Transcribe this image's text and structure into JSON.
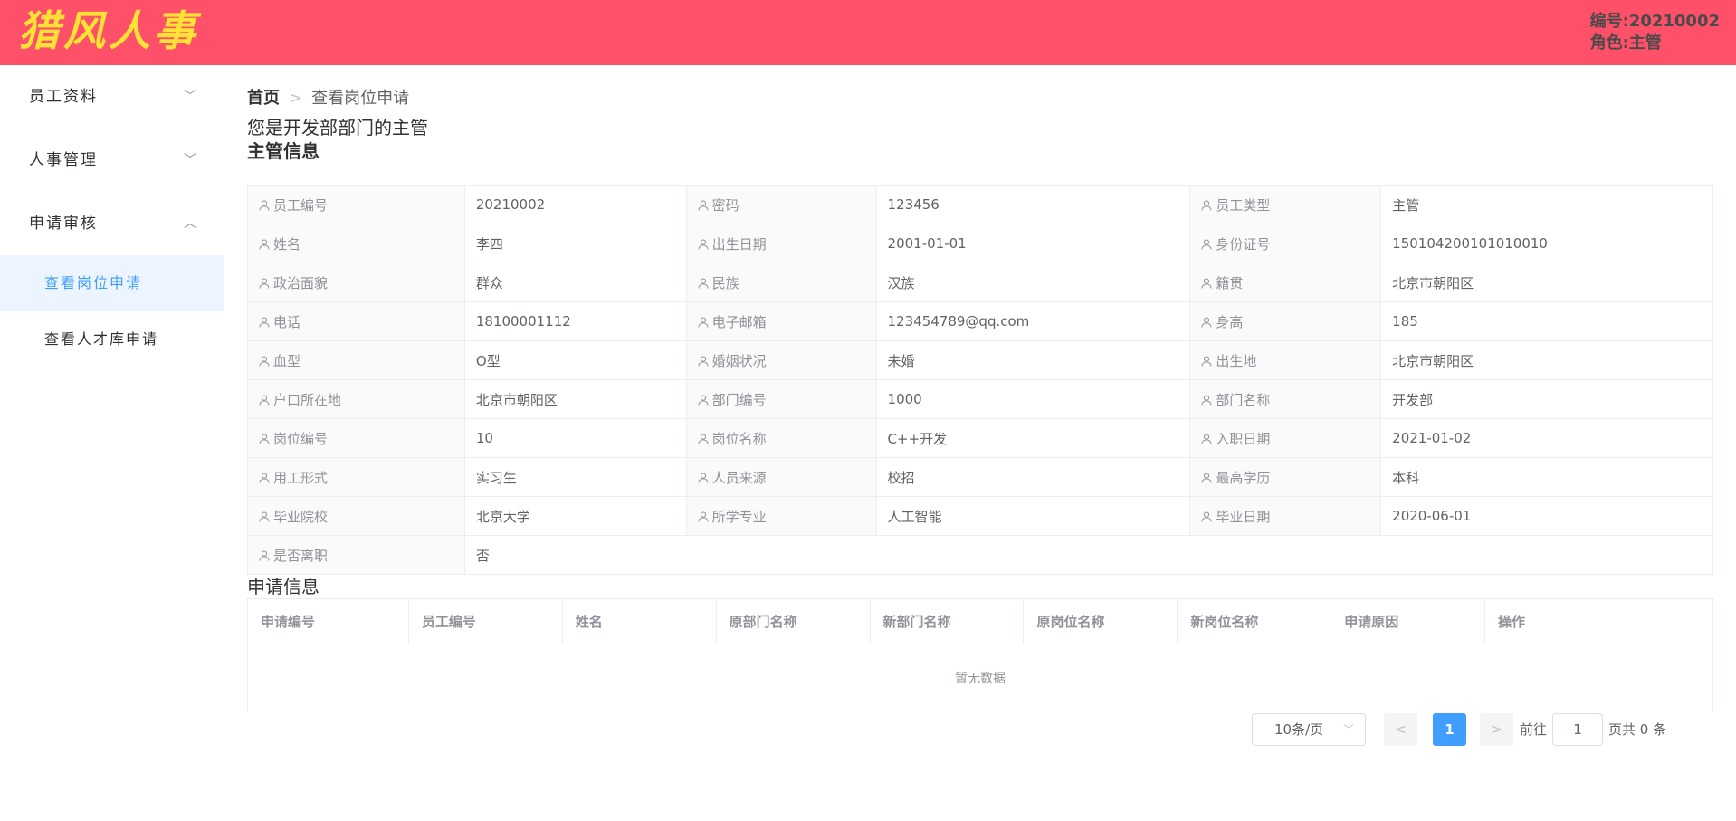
{
  "header": {
    "logo": "猎风人事",
    "user_no": "编号:20210002",
    "role": "角色:主管"
  },
  "sidebar": {
    "menus": [
      {
        "label": "员工资料",
        "chevron": "﹀"
      },
      {
        "label": "人事管理",
        "chevron": "﹀"
      },
      {
        "label": "申请审核",
        "chevron": "︿"
      }
    ],
    "sub_items": [
      {
        "label": "查看岗位申请",
        "active": true
      },
      {
        "label": "查看人才库申请",
        "active": false
      }
    ]
  },
  "breadcrumb": {
    "home": "首页",
    "separator": ">",
    "current": "查看岗位申请"
  },
  "intro": "您是开发部部门的主管",
  "manager_title": "主管信息",
  "details": [
    [
      {
        "label": "员工编号",
        "value": "20210002"
      },
      {
        "label": "密码",
        "value": "123456"
      },
      {
        "label": "员工类型",
        "value": "主管"
      }
    ],
    [
      {
        "label": "姓名",
        "value": "李四"
      },
      {
        "label": "出生日期",
        "value": "2001-01-01"
      },
      {
        "label": "身份证号",
        "value": "150104200101010010"
      }
    ],
    [
      {
        "label": "政治面貌",
        "value": "群众"
      },
      {
        "label": "民族",
        "value": "汉族"
      },
      {
        "label": "籍贯",
        "value": "北京市朝阳区"
      }
    ],
    [
      {
        "label": "电话",
        "value": "18100001112"
      },
      {
        "label": "电子邮箱",
        "value": "123454789@qq.com"
      },
      {
        "label": "身高",
        "value": "185"
      }
    ],
    [
      {
        "label": "血型",
        "value": "O型"
      },
      {
        "label": "婚姻状况",
        "value": "未婚"
      },
      {
        "label": "出生地",
        "value": "北京市朝阳区"
      }
    ],
    [
      {
        "label": "户口所在地",
        "value": "北京市朝阳区"
      },
      {
        "label": "部门编号",
        "value": "1000"
      },
      {
        "label": "部门名称",
        "value": "开发部"
      }
    ],
    [
      {
        "label": "岗位编号",
        "value": "10"
      },
      {
        "label": "岗位名称",
        "value": "C++开发"
      },
      {
        "label": "入职日期",
        "value": "2021-01-02"
      }
    ],
    [
      {
        "label": "用工形式",
        "value": "实习生"
      },
      {
        "label": "人员来源",
        "value": "校招"
      },
      {
        "label": "最高学历",
        "value": "本科"
      }
    ],
    [
      {
        "label": "毕业院校",
        "value": "北京大学"
      },
      {
        "label": "所学专业",
        "value": "人工智能"
      },
      {
        "label": "毕业日期",
        "value": "2020-06-01"
      }
    ],
    [
      {
        "label": "是否离职",
        "value": "否"
      }
    ]
  ],
  "apply_title": "申请信息",
  "apply_table": {
    "headers": [
      "申请编号",
      "员工编号",
      "姓名",
      "原部门名称",
      "新部门名称",
      "原岗位名称",
      "新岗位名称",
      "申请原因",
      "操作"
    ],
    "empty_text": "暂无数据"
  },
  "pagination": {
    "page_size": "10条/页",
    "size_arrow": "﹀",
    "prev": "<",
    "next": ">",
    "current_page": "1",
    "goto_label": "前往",
    "goto_value": "1",
    "total_text": "页共 0 条"
  },
  "colors": {
    "header_bg": "#ff5069",
    "logo": "#ffe234",
    "accent": "#409eff",
    "active_bg": "#ecf5ff"
  }
}
